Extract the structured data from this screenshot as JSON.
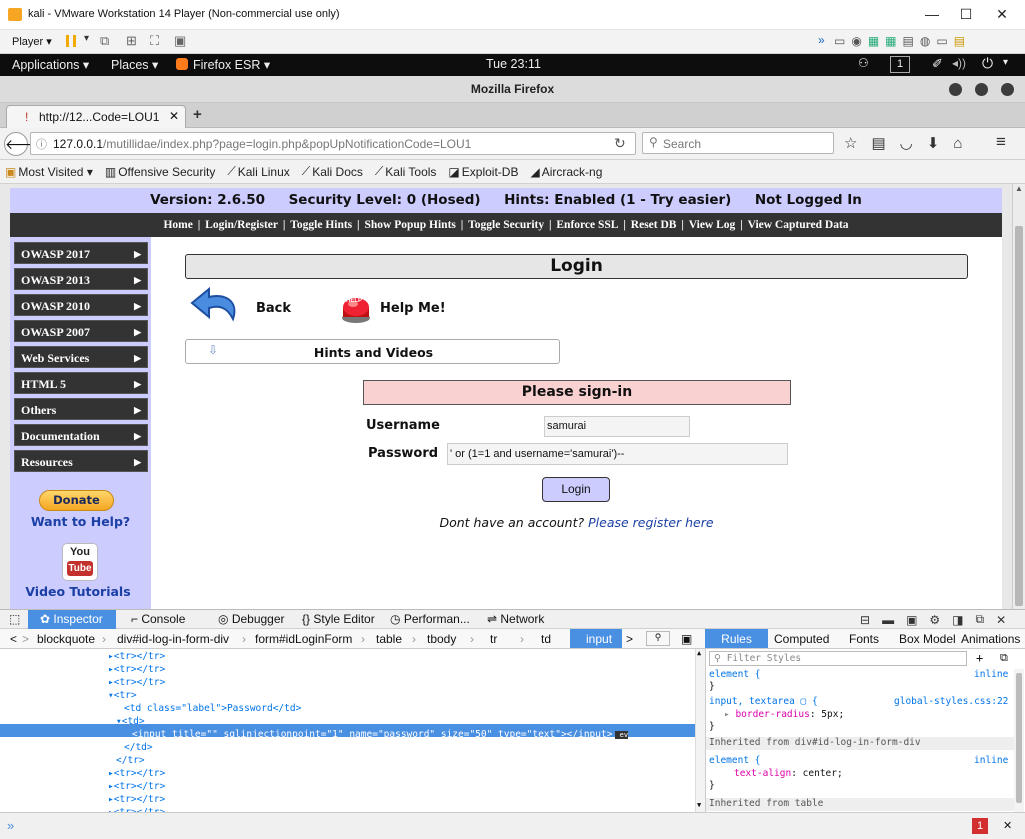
{
  "vm": {
    "title": "kali - VMware Workstation 14 Player (Non-commercial use only)",
    "player_label": "Player ▾"
  },
  "gnome": {
    "applications": "Applications ▾",
    "places": "Places ▾",
    "firefox": "Firefox ESR ▾",
    "clock": "Tue 23:11",
    "workspace": "1"
  },
  "firefox": {
    "window_title": "Mozilla Firefox",
    "tab_title": "http://12...Code=LOU1",
    "url_host": "127.0.0.1",
    "url_path": "/mutillidae/index.php?page=login.php&popUpNotificationCode=LOU1",
    "search_placeholder": "Search",
    "bookmarks": [
      "Most Visited ▾",
      "Offensive Security",
      "Kali Linux",
      "Kali Docs",
      "Kali Tools",
      "Exploit-DB",
      "Aircrack-ng"
    ]
  },
  "page": {
    "header_status": "Version: 2.6.50     Security Level: 0 (Hosed)     Hints: Enabled (1 - Try easier)     Not Logged In",
    "nav_links": [
      "Home",
      "Login/Register",
      "Toggle Hints",
      "Show Popup Hints",
      "Toggle Security",
      "Enforce SSL",
      "Reset DB",
      "View Log",
      "View Captured Data"
    ],
    "sidebar_items": [
      "OWASP 2017",
      "OWASP 2013",
      "OWASP 2010",
      "OWASP 2007",
      "Web Services",
      "HTML 5",
      "Others",
      "Documentation",
      "Resources"
    ],
    "donate": "Donate",
    "want_to_help": "Want to Help?",
    "youtube_top": "You",
    "youtube_bottom": "Tube",
    "video_tutorials": "Video Tutorials",
    "title": "Login",
    "back": "Back",
    "help_me": "Help Me!",
    "help_badge": "HELP",
    "hints_videos": "Hints and Videos",
    "signin_title": "Please sign-in",
    "username_label": "Username",
    "username_value": "samurai",
    "password_label": "Password",
    "password_value": "' or (1=1 and username='samurai')--",
    "login_button": "Login",
    "no_account": "Dont have an account?",
    "register_link": "Please register here"
  },
  "devtools": {
    "tabs": [
      "Inspector",
      "Console",
      "Debugger",
      "Style Editor",
      "Performan...",
      "Network"
    ],
    "breadcrumbs": [
      "blockquote",
      "div#id-log-in-form-div",
      "form#idLoginForm",
      "table",
      "tbody",
      "tr",
      "td",
      "input"
    ],
    "markup": [
      {
        "indent": 14,
        "text": "▸<tr></tr>"
      },
      {
        "indent": 14,
        "text": "▸<tr></tr>"
      },
      {
        "indent": 14,
        "text": "▸<tr></tr>"
      },
      {
        "indent": 14,
        "text": "▾<tr>"
      },
      {
        "indent": 16,
        "text": "<td class=\"label\">Password</td>"
      },
      {
        "indent": 15,
        "text": "▾<td>"
      },
      {
        "indent": 17,
        "text": "<input title=\"\" sqlinjectionpoint=\"1\" name=\"password\" size=\"50\" type=\"text\"></input>"
      },
      {
        "indent": 16,
        "text": "</td>"
      },
      {
        "indent": 15,
        "text": "</tr>"
      },
      {
        "indent": 14,
        "text": "▸<tr></tr>"
      },
      {
        "indent": 14,
        "text": "▸<tr></tr>"
      },
      {
        "indent": 14,
        "text": "▸<tr></tr>"
      },
      {
        "indent": 14,
        "text": "▸<tr></tr>"
      }
    ],
    "ev_badge": "ev",
    "rules_tabs": [
      "Rules",
      "Computed",
      "Fonts",
      "Box Model",
      "Animations"
    ],
    "filter_placeholder": "Filter Styles",
    "rules": {
      "element1_sel": "element {",
      "element1_src": "inline",
      "close1": "}",
      "input_sel": "input, textarea ▢ {",
      "input_src": "global-styles.css:22",
      "input_prop": "border-radius",
      "input_val": "5px",
      "close2": "}",
      "inherited1": "Inherited from div#id-log-in-form-div",
      "element2_sel": "element {",
      "element2_src": "inline",
      "element2_prop": "text-align",
      "element2_val": "center",
      "close3": "}",
      "inherited2": "Inherited from table"
    },
    "cmd_prompt": "»",
    "error_count": "1"
  }
}
